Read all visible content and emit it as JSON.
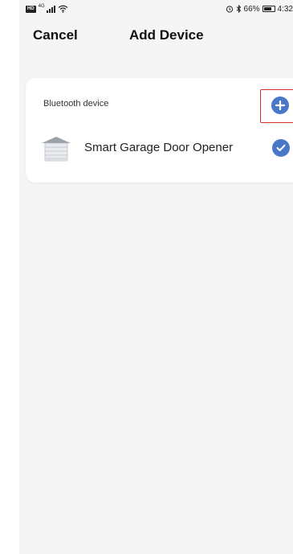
{
  "status": {
    "left_badge": "HD",
    "network": "4G",
    "battery_pct": "66%",
    "time": "4:32"
  },
  "nav": {
    "cancel_label": "Cancel",
    "title": "Add Device"
  },
  "section": {
    "label": "Bluetooth device"
  },
  "devices": [
    {
      "name": "Smart Garage Door Opener",
      "selected": true
    }
  ],
  "colors": {
    "accent": "#4a78c8",
    "highlight": "#d32f2f",
    "background": "#f5f5f5"
  }
}
